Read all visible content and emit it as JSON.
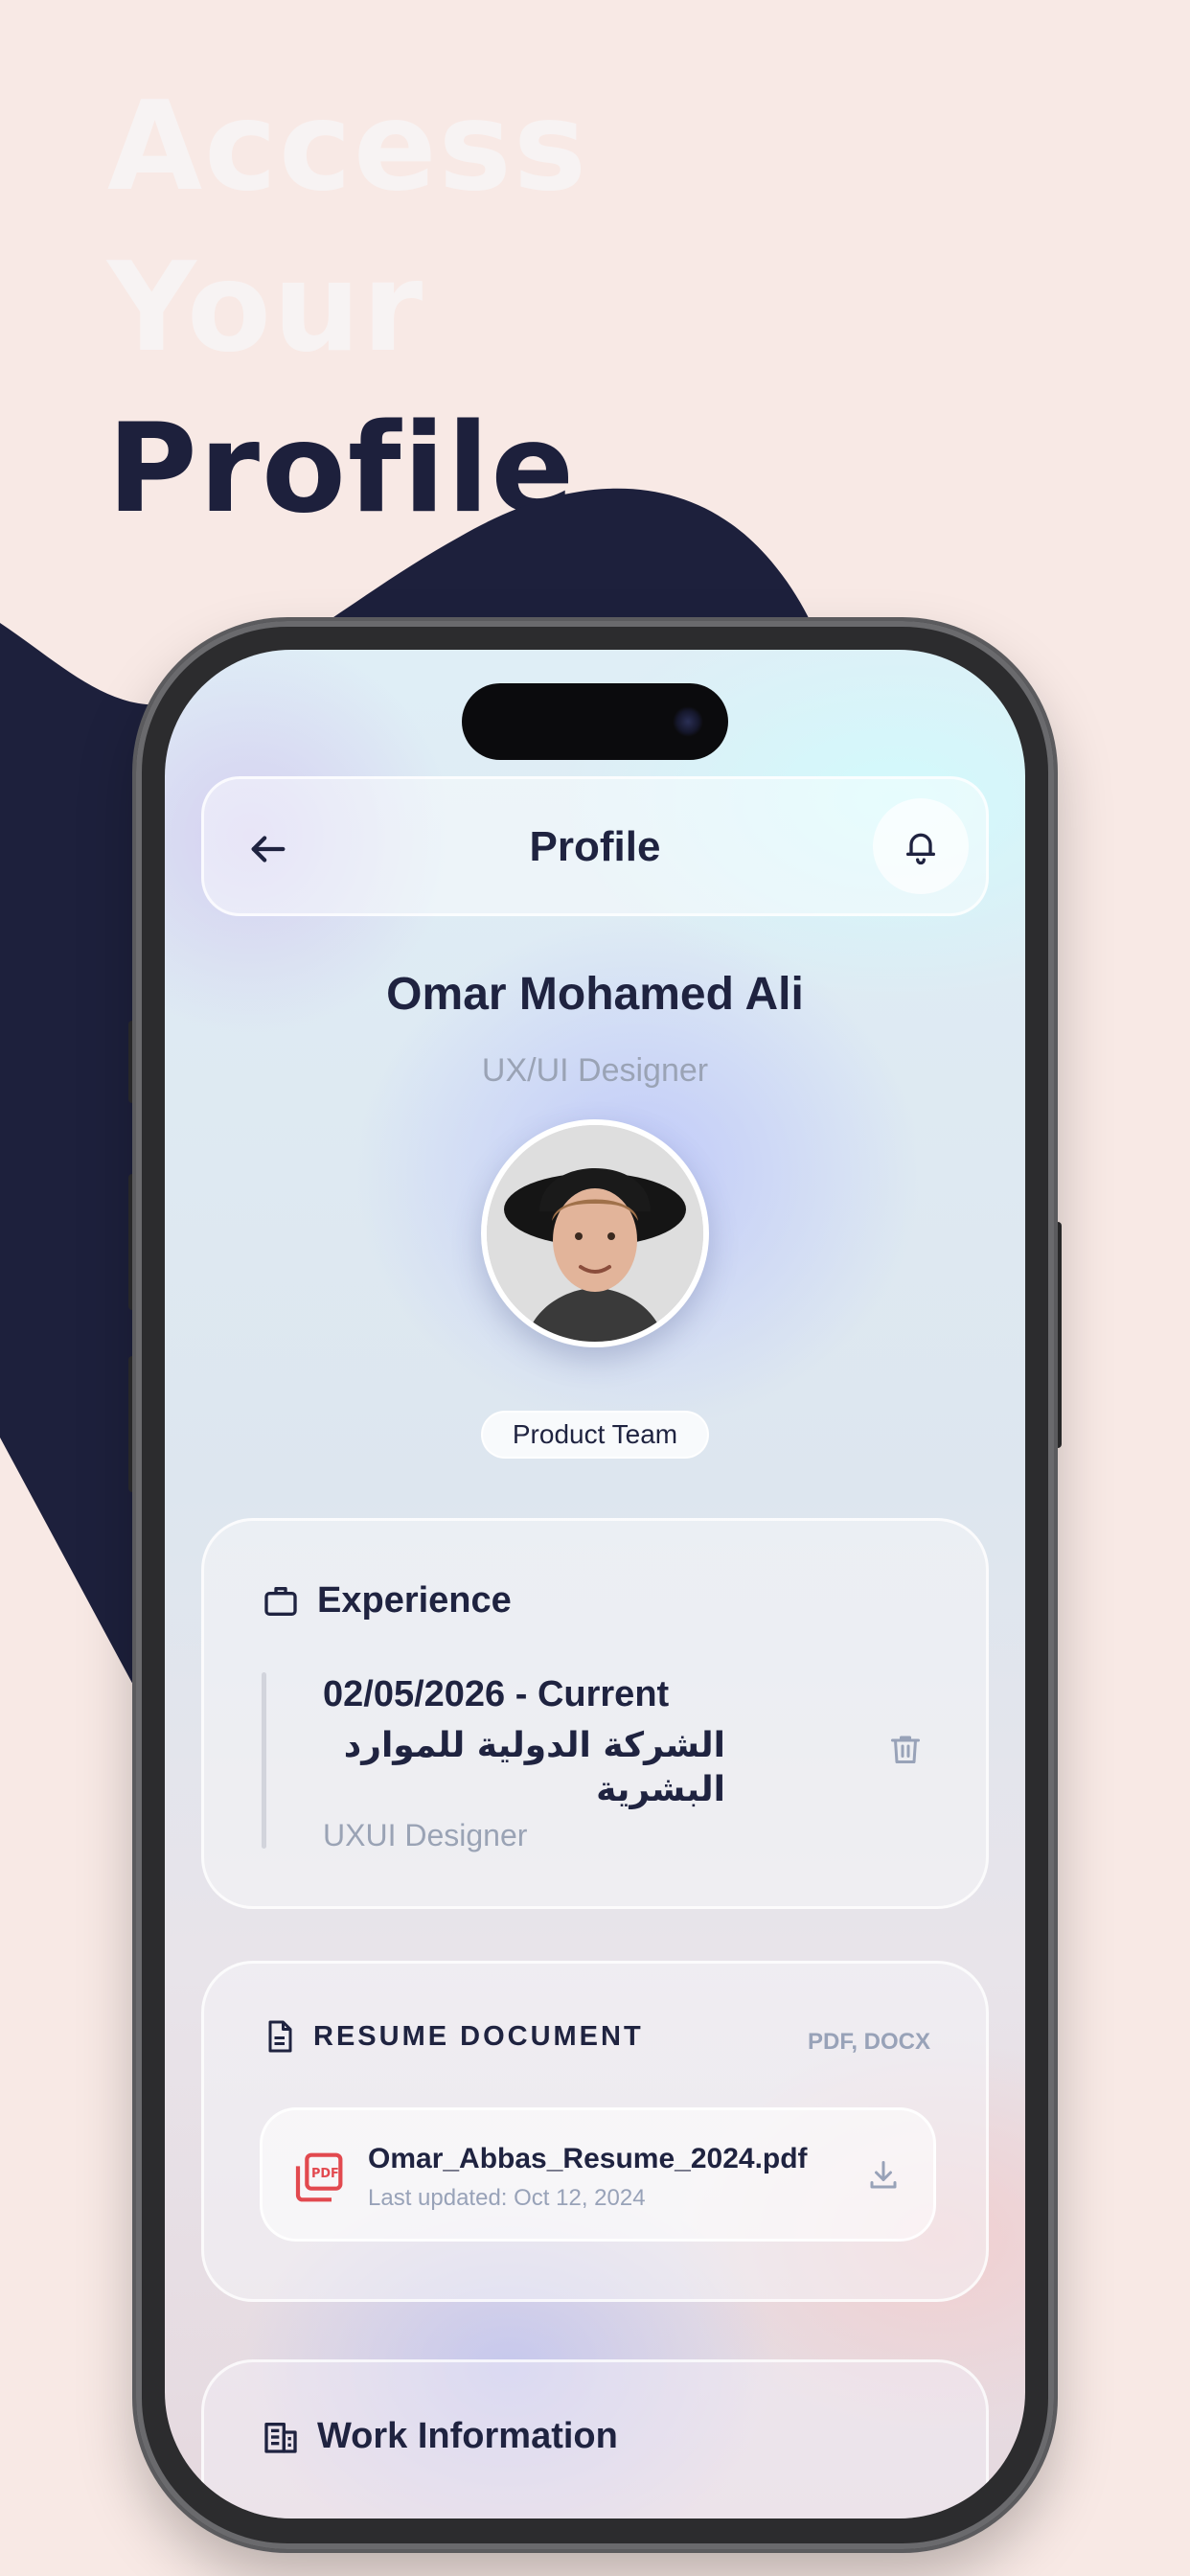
{
  "promo": {
    "line1": "Access",
    "line2": "Your",
    "line3": "Profile"
  },
  "colors": {
    "background": "#f8e9e5",
    "navy": "#1d203c",
    "text_primary": "#1f2340",
    "text_muted": "#9aa3b5",
    "pdf_red": "#e2494f"
  },
  "header": {
    "title": "Profile",
    "back_icon": "arrow-left-icon",
    "notification_icon": "bell-icon"
  },
  "profile": {
    "name": "Omar Mohamed Ali",
    "role": "UX/UI Designer",
    "team_badge": "Product Team"
  },
  "experience": {
    "title": "Experience",
    "icon": "briefcase-icon",
    "entry": {
      "dates": "02/05/2026 - Current",
      "company": "الشركة الدولية للموارد البشرية",
      "role": "UXUI Designer",
      "delete_icon": "trash-icon"
    }
  },
  "resume": {
    "title": "RESUME DOCUMENT",
    "formats": "PDF, DOCX",
    "icon": "document-icon",
    "file": {
      "name": "Omar_Abbas_Resume_2024.pdf",
      "updated": "Last updated: Oct 12, 2024",
      "file_icon": "pdf-file-icon",
      "download_icon": "download-icon"
    }
  },
  "work": {
    "title": "Work Information",
    "icon": "building-icon"
  }
}
